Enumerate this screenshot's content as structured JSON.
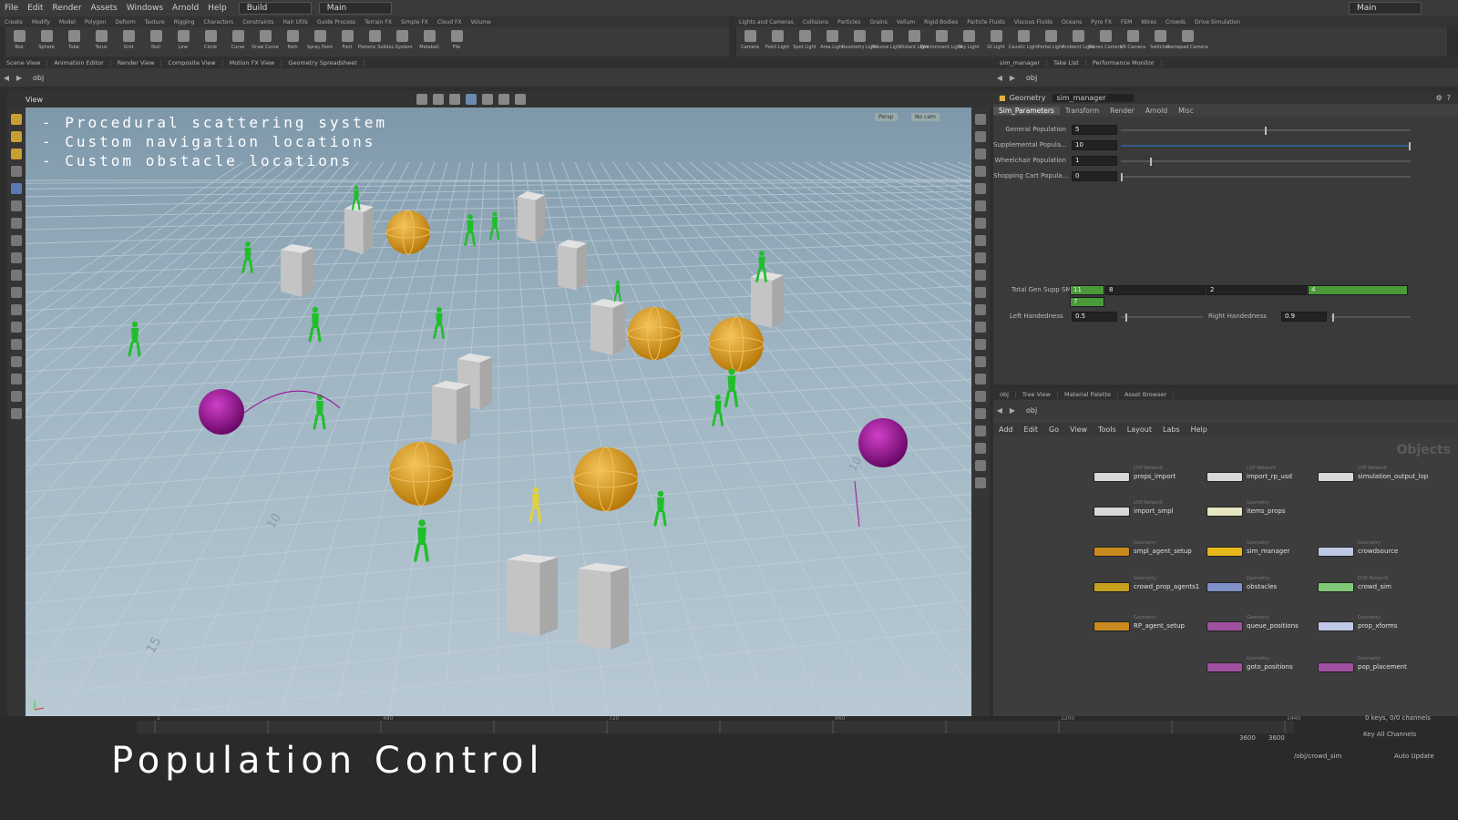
{
  "menubar": {
    "items": [
      "File",
      "Edit",
      "Render",
      "Assets",
      "Windows",
      "Arnold",
      "Help"
    ],
    "desktop": "Build",
    "main": "Main",
    "right_main": "Main"
  },
  "shelf_left": {
    "tabs": [
      "Create",
      "Modify",
      "Model",
      "Polygon",
      "Deform",
      "Texture",
      "Rigging",
      "Characters",
      "Constraints",
      "Hair Utils",
      "Guide Process",
      "Terrain FX",
      "Simple FX",
      "Cloud FX",
      "Volume"
    ],
    "tools": [
      "Box",
      "Sphere",
      "Tube",
      "Torus",
      "Grid",
      "Null",
      "Line",
      "Circle",
      "Curve",
      "Draw Curve",
      "Path",
      "Spray Paint",
      "Font",
      "Platonic Solids",
      "L-System",
      "Metaball",
      "File"
    ]
  },
  "shelf_right": {
    "tabs": [
      "Lights and Cameras",
      "Collisions",
      "Particles",
      "Grains",
      "Vellum",
      "Rigid Bodies",
      "Particle Fluids",
      "Viscous Fluids",
      "Oceans",
      "Pyro FX",
      "FEM",
      "Wires",
      "Crowds",
      "Drive Simulation"
    ],
    "tools": [
      "Camera",
      "Point Light",
      "Spot Light",
      "Area Light",
      "Geometry Light",
      "Volume Light",
      "Distant Light",
      "Environment Light",
      "Sky Light",
      "GI Light",
      "Caustic Light",
      "Portal Light",
      "Ambient Light",
      "Stereo Camera",
      "VR Camera",
      "Switcher",
      "Gamepad Camera"
    ]
  },
  "pane_tabs_left": [
    "Scene View",
    "Animation Editor",
    "Render View",
    "Composite View",
    "Motion FX View",
    "Geometry Spreadsheet"
  ],
  "pane_tabs_right": [
    "sim_manager",
    "Take List",
    "Performance Monitor"
  ],
  "path_left": "obj",
  "path_right": "obj",
  "view": {
    "title": "View",
    "persp": "Persp",
    "cam": "No cam",
    "overlay": [
      "- Procedural scattering system",
      "- Custom navigation locations",
      "- Custom obstacle locations"
    ],
    "grid_labels": [
      "10",
      "10",
      "15"
    ]
  },
  "props": {
    "type": "Geometry",
    "name": "sim_manager",
    "tabs": [
      "Sim_Parameters",
      "Transform",
      "Render",
      "Arnold",
      "Misc"
    ],
    "rows": [
      {
        "label": "General Population",
        "value": "5",
        "frac": 0.5
      },
      {
        "label": "Supplemental Popula...",
        "value": "10",
        "frac": 1.0
      },
      {
        "label": "Wheelchair Population",
        "value": "1",
        "frac": 0.1
      },
      {
        "label": "Shopping Cart Popula...",
        "value": "0",
        "frac": 0.0
      }
    ],
    "total_label": "Total Gen Supp SMP...",
    "total_values": [
      "11",
      "8",
      "2",
      "4"
    ],
    "total_extra": "7",
    "left_hand_label": "Left Handedness",
    "left_hand_value": "0.5",
    "right_hand_label": "Right Handedness",
    "right_hand_value": "0.9"
  },
  "net": {
    "tabs": [
      "obj",
      "Tree View",
      "Material Palette",
      "Asset Browser"
    ],
    "path": "obj",
    "menu": [
      "Add",
      "Edit",
      "Go",
      "View",
      "Tools",
      "Layout",
      "Labs",
      "Help"
    ],
    "context": "Objects",
    "nodes": [
      {
        "name": "props_import",
        "sub": "LOP Network",
        "color": "#d8d8d8"
      },
      {
        "name": "import_rp_usd",
        "sub": "LOP Network",
        "color": "#d8d8d8"
      },
      {
        "name": "simulation_output_lop",
        "sub": "LOP Network",
        "color": "#d8d8d8"
      },
      {
        "name": "import_smpl",
        "sub": "LOP Network",
        "color": "#d8d8d8"
      },
      {
        "name": "items_props",
        "sub": "Geometry",
        "color": "#e6e6c0"
      },
      {
        "name": "smpl_agent_setup",
        "sub": "Geometry",
        "color": "#c88a1e"
      },
      {
        "name": "sim_manager",
        "sub": "Geometry",
        "color": "#e6b81a"
      },
      {
        "name": "crowdsource",
        "sub": "Geometry",
        "color": "#c0c8e8"
      },
      {
        "name": "crowd_prop_agents1",
        "sub": "Geometry",
        "color": "#c8a020"
      },
      {
        "name": "obstacles",
        "sub": "Geometry",
        "color": "#8090c8"
      },
      {
        "name": "crowd_sim",
        "sub": "DOP Network",
        "color": "#80c878"
      },
      {
        "name": "RP_agent_setup",
        "sub": "Geometry",
        "color": "#c88a1e"
      },
      {
        "name": "queue_positions",
        "sub": "Geometry",
        "color": "#a050a0"
      },
      {
        "name": "prop_xforms",
        "sub": "Geometry",
        "color": "#c0c8e8"
      },
      {
        "name": "goto_positions",
        "sub": "Geometry",
        "color": "#a050a0"
      },
      {
        "name": "pop_placement",
        "sub": "Geometry",
        "color": "#a050a0"
      }
    ]
  },
  "timeline": {
    "frame_end_a": "3600",
    "frame_end_b": "3600",
    "keys": "0 keys, 0/0 channels",
    "keyall": "Key All Channels",
    "path": "/obj/crowd_sim",
    "update": "Auto Update",
    "ticks": [
      "1",
      "",
      "480",
      "",
      "720",
      "",
      "960",
      "",
      "1200",
      "",
      "1440"
    ]
  },
  "caption": "Population Control",
  "colors": {
    "green": "#1fbf2a",
    "orange": "#e0a21c",
    "magenta": "#a0109a",
    "box": "#c8c8c8"
  }
}
